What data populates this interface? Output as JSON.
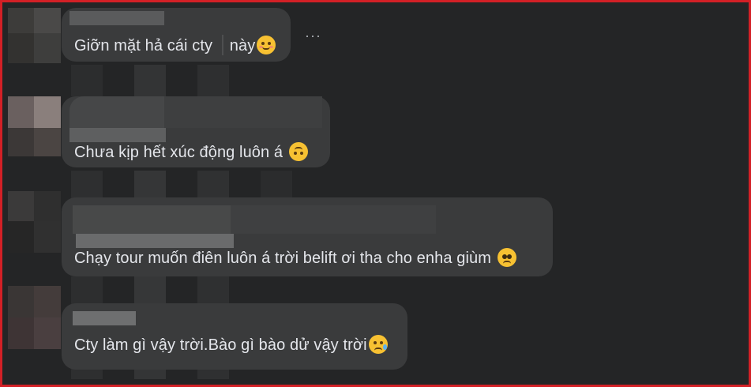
{
  "comments": [
    {
      "text": "Giỡn mặt hả cái cty",
      "text2": "này",
      "emoji": "relieved-face-emoji"
    },
    {
      "text": "Chưa kịp hết xúc động luôn á ",
      "emoji": "upside-down-face-emoji"
    },
    {
      "text": "Chạy tour muốn điên luôn á trời belift ơi tha cho enha giùm ",
      "emoji": "pleading-face-emoji"
    },
    {
      "text": "Cty làm gì vậy trời.Bào gì bào dử vậy trời",
      "emoji": "crying-face-emoji"
    }
  ],
  "more_icon_label": "···",
  "colors": {
    "border": "#d32026",
    "background": "#242526",
    "bubble": "#3a3b3c",
    "text": "#e4e6eb"
  }
}
